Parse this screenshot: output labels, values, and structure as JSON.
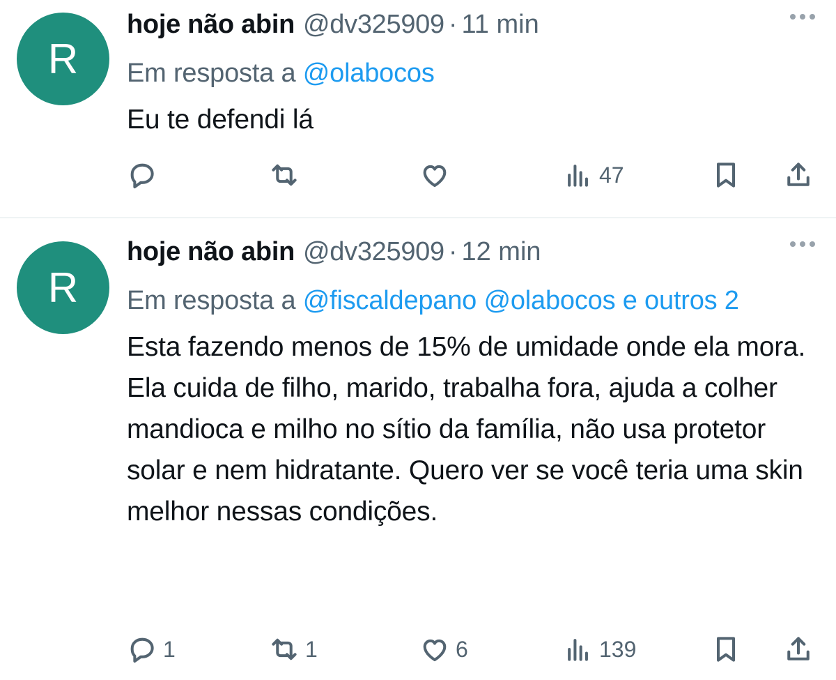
{
  "tweets": [
    {
      "avatar_letter": "R",
      "avatar_color": "#1f8f7d",
      "name": "hoje não abin",
      "handle": "@dv325909",
      "separator": "·",
      "time": "11 min",
      "reply_prefix": "Em resposta a",
      "reply_mentions": "@olabocos",
      "text": "Eu te defendi lá",
      "counts": {
        "replies": "",
        "retweets": "",
        "likes": "",
        "views": "47"
      }
    },
    {
      "avatar_letter": "R",
      "avatar_color": "#1f8f7d",
      "name": "hoje não abin",
      "handle": "@dv325909",
      "separator": "·",
      "time": "12 min",
      "reply_prefix": "Em resposta a",
      "reply_mentions": "@fiscaldepano @olabocos e outros 2",
      "text": "Esta fazendo menos de 15% de umidade onde ela mora. Ela cuida de filho, marido, trabalha fora, ajuda a colher mandioca e milho no sítio da família, não usa protetor solar e nem hidratante. Quero ver se você teria uma skin melhor nessas condições.",
      "counts": {
        "replies": "1",
        "retweets": "1",
        "likes": "6",
        "views": "139"
      }
    }
  ],
  "colors": {
    "link": "#1d9bf0",
    "secondary": "#536471",
    "primary": "#0f1419",
    "divider": "#eff3f4"
  },
  "icons": [
    "more-icon",
    "reply-icon",
    "retweet-icon",
    "like-icon",
    "views-icon",
    "bookmark-icon",
    "share-icon"
  ]
}
